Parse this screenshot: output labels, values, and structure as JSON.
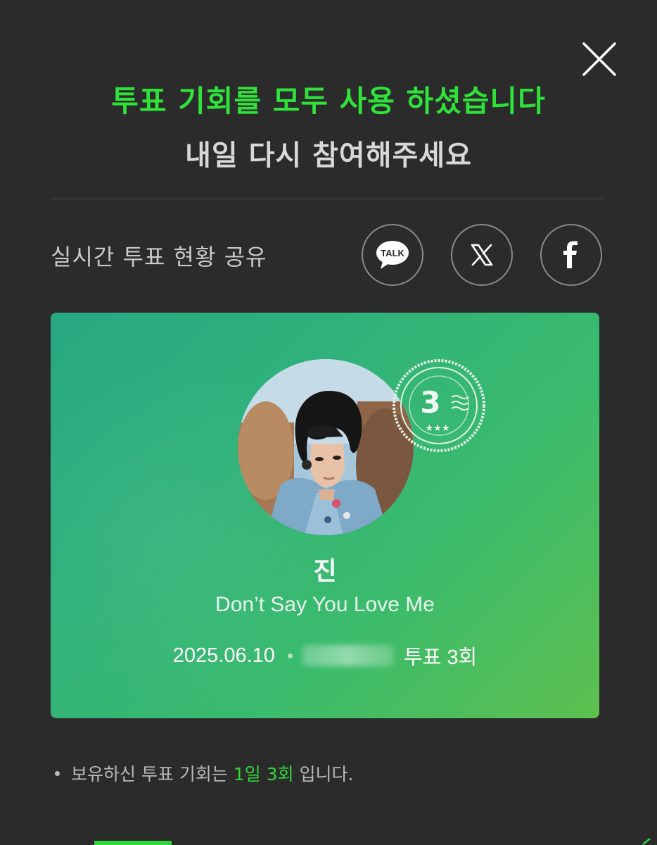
{
  "header": {
    "title": "투표 기회를 모두 사용 하셨습니다",
    "subtitle": "내일 다시 참여해주세요"
  },
  "share": {
    "label": "실시간 투표 현황 공유",
    "kakao_text": "TALK",
    "buttons": [
      {
        "name": "kakaotalk",
        "icon": "kakaotalk-icon"
      },
      {
        "name": "x",
        "icon": "x-icon"
      },
      {
        "name": "facebook",
        "icon": "facebook-icon"
      }
    ]
  },
  "card": {
    "artist": "진",
    "song": "Don’t Say You Love Me",
    "date": "2025.06.10",
    "votes": "투표 3회",
    "stamp_number": "3",
    "stamp_stars": "★★★"
  },
  "notice": {
    "prefix": "보유하신 투표 기회는 ",
    "highlight": "1일 3회",
    "suffix": " 입니다."
  },
  "colors": {
    "accent_green": "#2fe23a",
    "background": "#2b2b2b",
    "card_gradient_start": "#27a882",
    "card_gradient_end": "#5ec04f"
  }
}
